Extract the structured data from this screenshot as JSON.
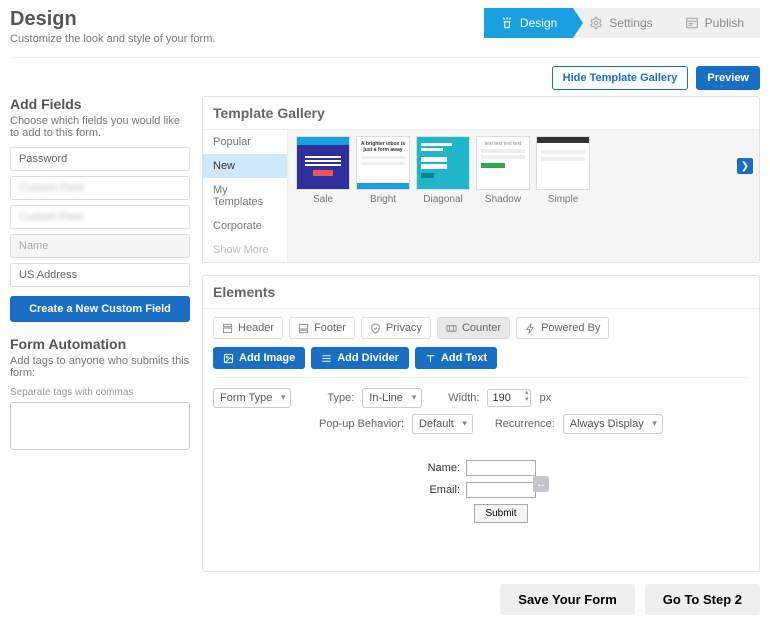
{
  "header": {
    "title": "Design",
    "subtitle": "Customize the look and style of your form."
  },
  "stepper": {
    "design": "Design",
    "settings": "Settings",
    "publish": "Publish"
  },
  "actions": {
    "hide_gallery": "Hide Template Gallery",
    "preview": "Preview",
    "save": "Save Your Form",
    "next_step": "Go To Step 2"
  },
  "add_fields": {
    "title": "Add Fields",
    "sub": "Choose which fields you would like to add to this form.",
    "items": [
      "Password",
      "",
      "",
      "Name",
      "US Address"
    ],
    "create_btn": "Create a New Custom Field"
  },
  "automation": {
    "title": "Form Automation",
    "sub": "Add tags to anyone who submits this form:",
    "hint": "Separate tags with commas"
  },
  "gallery": {
    "title": "Template Gallery",
    "cats": [
      "Popular",
      "New",
      "My Templates",
      "Corporate",
      "Show More"
    ],
    "templates": [
      "Sale",
      "Bright",
      "Diagonal",
      "Shadow",
      "Simple"
    ],
    "bright_headline": "A brighter inbox is just a form away"
  },
  "elements": {
    "title": "Elements",
    "chips": [
      "Header",
      "Footer",
      "Privacy",
      "Counter",
      "Powered By"
    ],
    "pills": {
      "image": "Add Image",
      "divider": "Add Divider",
      "text": "Add Text"
    },
    "form_type_label": "Form Type",
    "type_label": "Type:",
    "type_value": "In-Line",
    "width_label": "Width:",
    "width_value": "190",
    "width_unit": "px",
    "popup_label": "Pop-up Behavior:",
    "popup_value": "Default",
    "recurrence_label": "Recurrence:",
    "recurrence_value": "Always Display"
  },
  "preview": {
    "name_label": "Name:",
    "email_label": "Email:",
    "submit": "Submit"
  }
}
